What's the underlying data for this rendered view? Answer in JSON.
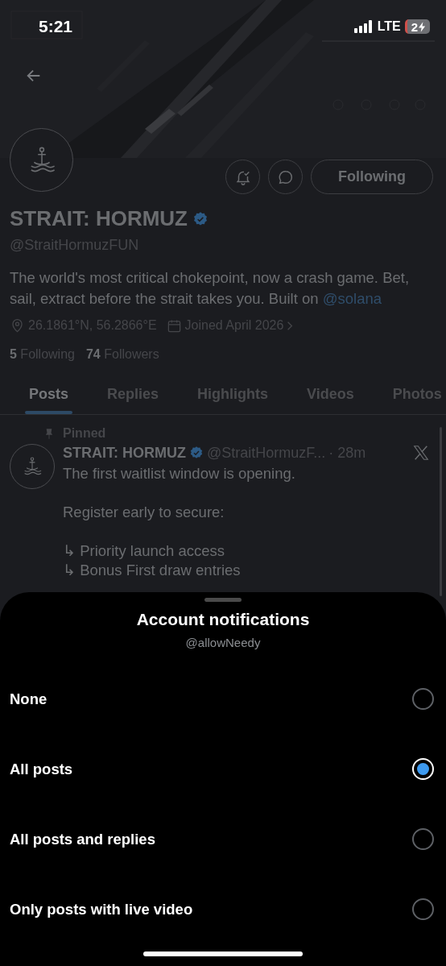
{
  "status_bar": {
    "time": "5:21",
    "network": "LTE",
    "battery": "2"
  },
  "profile": {
    "name": "STRAIT: HORMUZ",
    "verified": true,
    "handle": "@StraitHormuzFUN",
    "follow_button": "Following",
    "bio": "The world's most critical chokepoint, now a crash game. Bet, sail, extract before the strait takes you. Built on ",
    "bio_link": "@solana",
    "location": "26.1861°N, 56.2866°E",
    "joined": "Joined April 2026",
    "following_count": "5",
    "following_label": "Following",
    "followers_count": "74",
    "followers_label": "Followers"
  },
  "tabs": [
    {
      "label": "Posts",
      "selected": true
    },
    {
      "label": "Replies",
      "selected": false
    },
    {
      "label": "Highlights",
      "selected": false
    },
    {
      "label": "Videos",
      "selected": false
    },
    {
      "label": "Photos",
      "selected": false
    }
  ],
  "post": {
    "pinned_label": "Pinned",
    "author": "STRAIT: HORMUZ",
    "verified": true,
    "handle": "@StraitHormuzF...",
    "time": "· 28m",
    "paragraphs": [
      [
        "The first waitlist window is opening."
      ],
      [
        "Register early to secure:"
      ],
      [
        "↳ Priority launch access",
        "↳ Bonus First draw entries"
      ]
    ]
  },
  "sheet": {
    "title": "Account notifications",
    "subtitle": "@allowNeedy",
    "options": [
      {
        "label": "None",
        "selected": false
      },
      {
        "label": "All posts",
        "selected": true
      },
      {
        "label": "All posts and replies",
        "selected": false
      },
      {
        "label": "Only posts with live video",
        "selected": false
      }
    ]
  }
}
